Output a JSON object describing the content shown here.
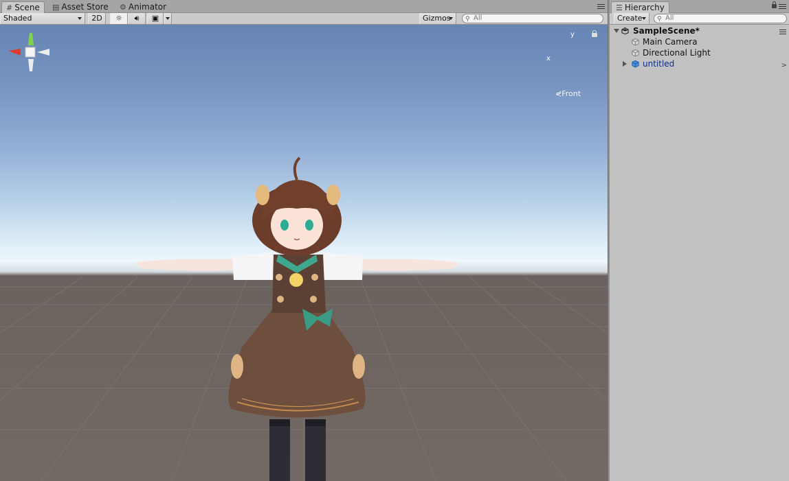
{
  "scene_panel": {
    "tabs": [
      {
        "label": "Scene",
        "icon": "grid-icon"
      },
      {
        "label": "Asset Store",
        "icon": "store-icon"
      },
      {
        "label": "Animator",
        "icon": "animator-icon"
      }
    ],
    "toolbar": {
      "draw_mode": "Shaded",
      "mode_2d": "2D",
      "gizmos_label": "Gizmos",
      "search_placeholder": "All"
    },
    "gizmo": {
      "y_label": "y",
      "x_label": "x",
      "view_label": "Front"
    }
  },
  "hierarchy": {
    "tab_label": "Hierarchy",
    "create_label": "Create",
    "search_placeholder": "All",
    "scene_name": "SampleScene*",
    "items": [
      {
        "label": "Main Camera",
        "icon": "gameobject-icon"
      },
      {
        "label": "Directional Light",
        "icon": "gameobject-icon"
      },
      {
        "label": "untitled",
        "icon": "prefab-icon"
      }
    ]
  },
  "colors": {
    "prefab_text": "#0d2c8a",
    "gizmo_x": "#e23a2a",
    "gizmo_y": "#7fd34a",
    "sky_top": "#6685b4",
    "ground": "#6d6460"
  }
}
